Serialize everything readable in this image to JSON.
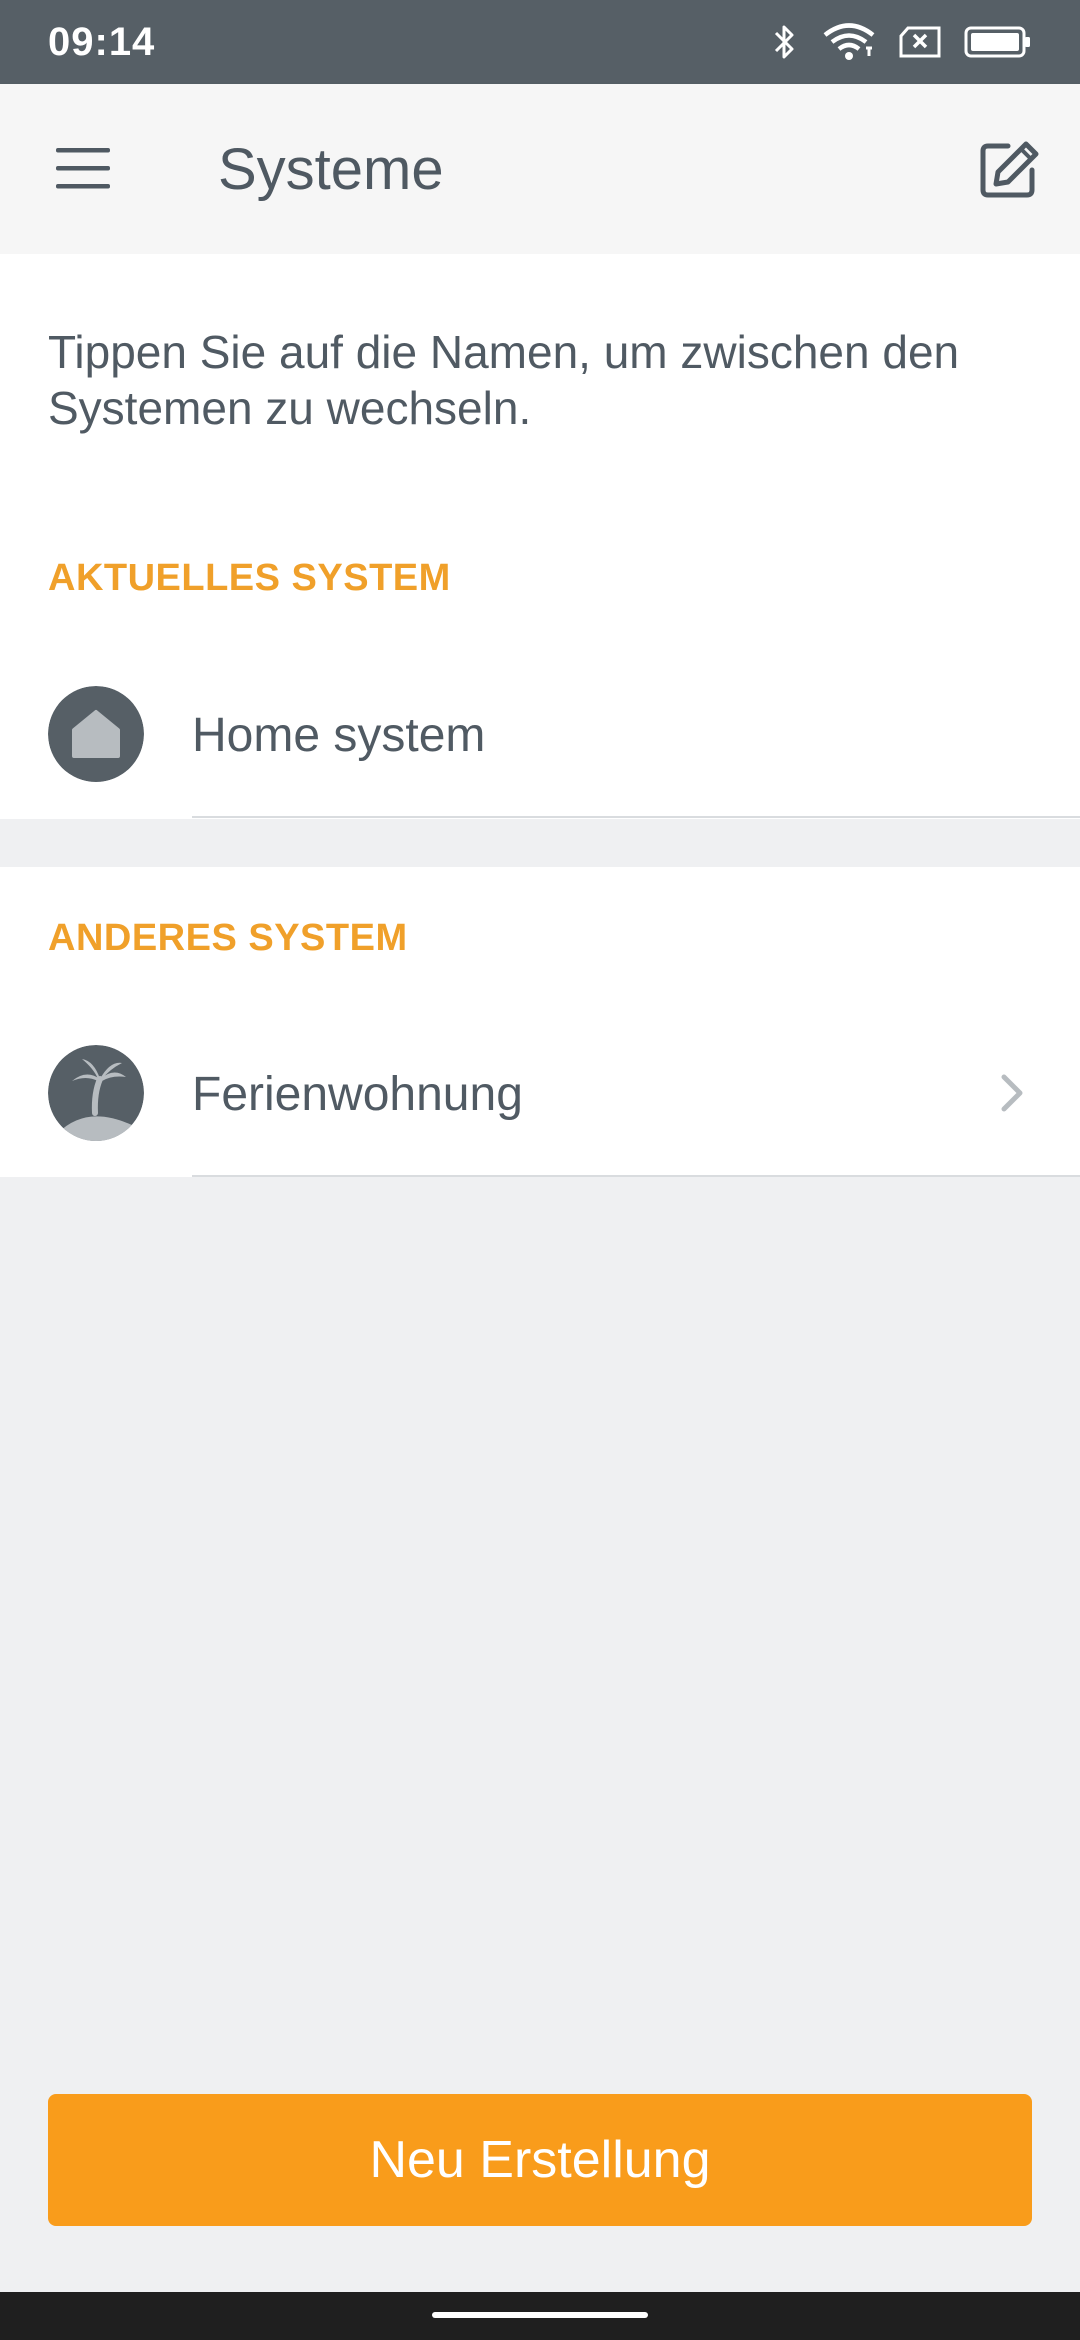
{
  "status_bar": {
    "time": "09:14",
    "icons": [
      "bluetooth-icon",
      "wifi-icon",
      "no-sim-icon",
      "battery-icon"
    ]
  },
  "app_bar": {
    "title": "Systeme",
    "menu_icon": "menu-icon",
    "edit_icon": "edit-icon"
  },
  "intro_text": "Tippen Sie auf die Namen, um zwischen den Systemen zu wechseln.",
  "current_system": {
    "section_label": "AKTUELLES SYSTEM",
    "name": "Home system",
    "icon": "house-icon"
  },
  "other_system": {
    "section_label": "ANDERES SYSTEM",
    "name": "Ferienwohnung",
    "icon": "palm-island-icon"
  },
  "primary_button": {
    "label": "Neu Erstellung"
  },
  "colors": {
    "accent": "#f99c1b",
    "section_label": "#f0a02a",
    "status_bar": "#565f66",
    "text": "#505a63",
    "background": "#eff0f2"
  }
}
